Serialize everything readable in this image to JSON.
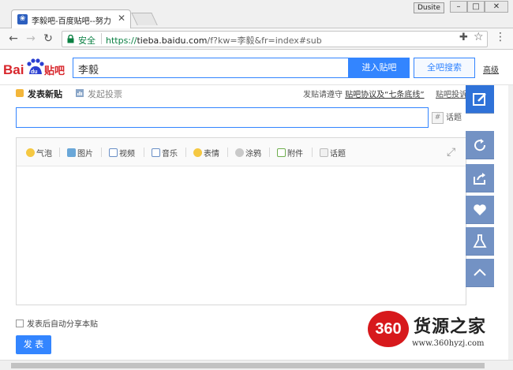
{
  "browser": {
    "tab_title": "李毅吧-百度贴吧--努力",
    "profile_name": "Dusite",
    "secure_label": "安全",
    "url_scheme": "https://",
    "url_host": "tieba.baidu.com",
    "url_path": "/f?kw=李毅&fr=index#sub"
  },
  "header": {
    "logo_alt": "Baidu贴吧",
    "search_value": "李毅",
    "enter_button": "进入贴吧",
    "all_search_button": "全吧搜索",
    "advanced_link": "高级"
  },
  "compose": {
    "tab_post": "发表新贴",
    "tab_vote": "发起投票",
    "rules_prefix": "发贴请遵守",
    "rules_link": "贴吧协议及“七条底线”",
    "ads_link": "贴吧投诉",
    "topic_label": "话题",
    "tools": [
      "气泡",
      "图片",
      "视频",
      "音乐",
      "表情",
      "涂鸦",
      "附件",
      "话题"
    ],
    "autoshare_label": "发表后自动分享本贴",
    "submit_label": "发 表"
  },
  "watermark": {
    "badge": "360",
    "name": "货源之家",
    "url": "www.360hyzj.com"
  },
  "colors": {
    "accent": "#3385ff",
    "side_active": "#2f72d8",
    "side_normal": "#7392c4",
    "watermark_red": "#d7191c"
  },
  "icons": {
    "side": [
      "edit-icon",
      "refresh-icon",
      "share-icon",
      "heart-icon",
      "flask-icon",
      "chevron-up-icon"
    ]
  }
}
